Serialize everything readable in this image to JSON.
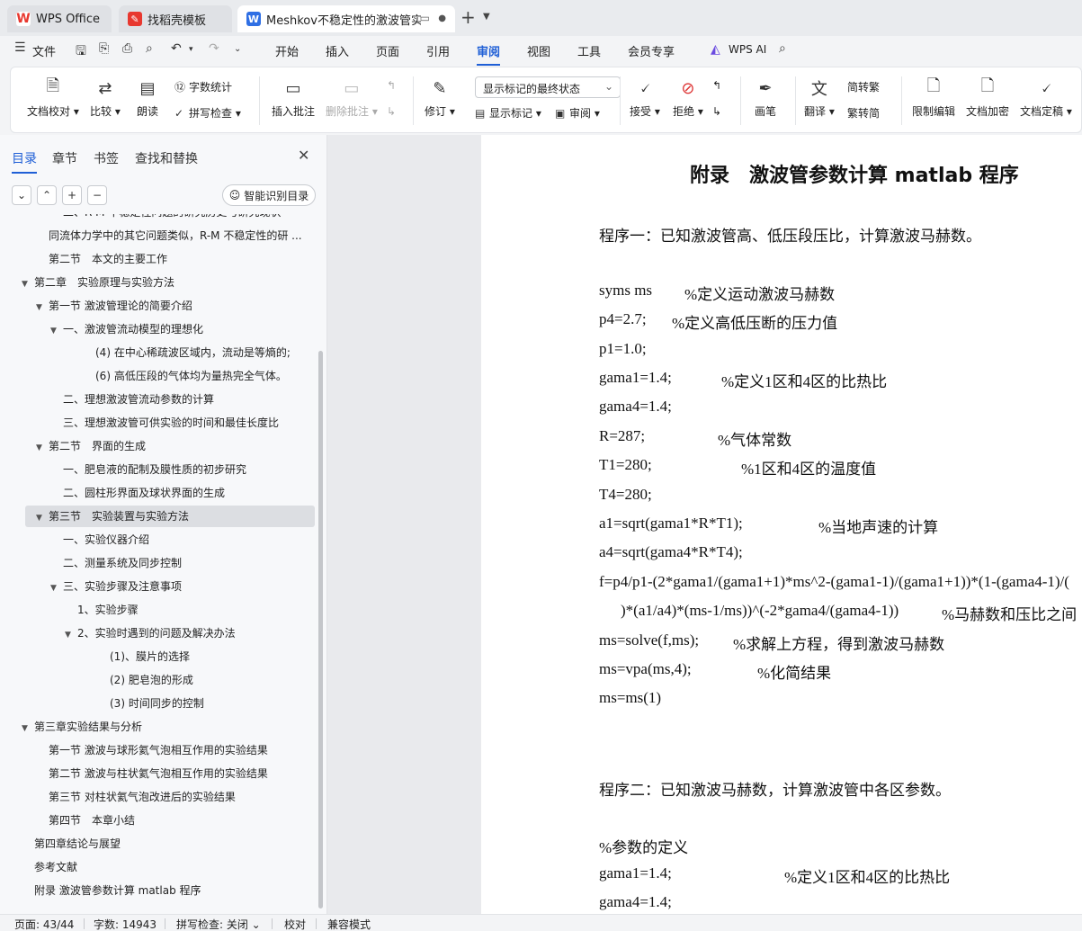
{
  "tabs": {
    "wps_office": "WPS Office",
    "template": "找稻壳模板",
    "document": "Meshkov不稳定性的激波管实"
  },
  "menu": {
    "file": "文件",
    "items": [
      "开始",
      "插入",
      "页面",
      "引用",
      "审阅",
      "视图",
      "工具",
      "会员专享"
    ],
    "active": "审阅",
    "wps_ai": "WPS AI"
  },
  "ribbon": {
    "doc_check": "文档校对",
    "compare": "比较",
    "read_aloud": "朗读",
    "word_count": "字数统计",
    "spell_check": "拼写检查",
    "insert_comment": "插入批注",
    "delete_comment": "删除批注",
    "revise": "修订",
    "markup_mode": "显示标记的最终状态",
    "show_markup": "显示标记",
    "review_pane": "审阅",
    "accept": "接受",
    "reject": "拒绝",
    "pen": "画笔",
    "translate": "翻译",
    "to_traditional": "简转繁",
    "to_simplified": "繁转简",
    "restrict_edit": "限制编辑",
    "encrypt": "文档加密",
    "finalize": "文档定稿"
  },
  "sidebar": {
    "tabs": [
      "目录",
      "章节",
      "书签",
      "查找和替换"
    ],
    "smart_toc": "智能识别目录",
    "toc": [
      {
        "text": "二、R-M 不稳定性问题的研究历史与研究现状",
        "level": 3,
        "arrow": ""
      },
      {
        "text": "同流体力学中的其它问题类似，R-M 不稳定性的研 ...",
        "level": 2,
        "arrow": ""
      },
      {
        "text": "第二节　本文的主要工作",
        "level": 2,
        "arrow": ""
      },
      {
        "text": "第二章　实验原理与实验方法",
        "level": 1,
        "arrow": "▼"
      },
      {
        "text": "第一节  激波管理论的简要介绍",
        "level": 2,
        "arrow": "▼"
      },
      {
        "text": "一、激波管流动模型的理想化",
        "level": 3,
        "arrow": "▼"
      },
      {
        "text": "(4) 在中心稀疏波区域内，流动是等熵的;",
        "level": 5,
        "arrow": ""
      },
      {
        "text": "(6) 高低压段的气体均为量热完全气体。",
        "level": 5,
        "arrow": ""
      },
      {
        "text": "二、理想激波管流动参数的计算",
        "level": 3,
        "arrow": ""
      },
      {
        "text": "三、理想激波管可供实验的时间和最佳长度比",
        "level": 3,
        "arrow": ""
      },
      {
        "text": "第二节　界面的生成",
        "level": 2,
        "arrow": "▼"
      },
      {
        "text": "一、肥皂液的配制及膜性质的初步研究",
        "level": 3,
        "arrow": ""
      },
      {
        "text": "二、圆柱形界面及球状界面的生成",
        "level": 3,
        "arrow": ""
      },
      {
        "text": "第三节　实验装置与实验方法",
        "level": 2,
        "arrow": "▼",
        "selected": true
      },
      {
        "text": "一、实验仪器介绍",
        "level": 3,
        "arrow": ""
      },
      {
        "text": "二、测量系统及同步控制",
        "level": 3,
        "arrow": ""
      },
      {
        "text": "三、实验步骤及注意事项",
        "level": 3,
        "arrow": "▼"
      },
      {
        "text": "1、实验步骤",
        "level": 4,
        "arrow": ""
      },
      {
        "text": "2、实验时遇到的问题及解决办法",
        "level": 4,
        "arrow": "▼"
      },
      {
        "text": "(1)、膜片的选择",
        "level": 6,
        "arrow": ""
      },
      {
        "text": "(2) 肥皂泡的形成",
        "level": 6,
        "arrow": ""
      },
      {
        "text": "(3) 时间同步的控制",
        "level": 6,
        "arrow": ""
      },
      {
        "text": "第三章实验结果与分析",
        "level": 1,
        "arrow": "▼"
      },
      {
        "text": "第一节  激波与球形氦气泡相互作用的实验结果",
        "level": 2,
        "arrow": ""
      },
      {
        "text": "第二节  激波与柱状氦气泡相互作用的实验结果",
        "level": 2,
        "arrow": ""
      },
      {
        "text": "第三节  对柱状氦气泡改进后的实验结果",
        "level": 2,
        "arrow": ""
      },
      {
        "text": "第四节　本章小结",
        "level": 2,
        "arrow": ""
      },
      {
        "text": "第四章结论与展望",
        "level": 1,
        "arrow": ""
      },
      {
        "text": "参考文献",
        "level": 1,
        "arrow": ""
      },
      {
        "text": "附录  激波管参数计算 matlab 程序",
        "level": 1,
        "arrow": ""
      }
    ]
  },
  "document": {
    "title": "附录　激波管参数计算 matlab 程序",
    "lines": [
      {
        "code": "程序一：已知激波管高、低压段压比，计算激波马赫数。",
        "comment": ""
      },
      {
        "code": "",
        "comment": ""
      },
      {
        "code": "syms ms",
        "comment": "%定义运动激波马赫数"
      },
      {
        "code": "p4=2.7;",
        "comment": "%定义高低压断的压力值"
      },
      {
        "code": "p1=1.0;",
        "comment": ""
      },
      {
        "code": "gama1=1.4;",
        "comment": "%定义1区和4区的比热比"
      },
      {
        "code": "gama4=1.4;",
        "comment": ""
      },
      {
        "code": "R=287;",
        "comment": "%气体常数"
      },
      {
        "code": "T1=280;",
        "comment": "%1区和4区的温度值"
      },
      {
        "code": "T4=280;",
        "comment": ""
      },
      {
        "code": "a1=sqrt(gama1*R*T1);",
        "comment": "%当地声速的计算"
      },
      {
        "code": "a4=sqrt(gama4*R*T4);",
        "comment": ""
      },
      {
        "code": "f=p4/p1-(2*gama1/(gama1+1)*ms^2-(gama1-1)/(gama1+1))*(1-(gama4-1)/(",
        "comment": ""
      },
      {
        "code": ")*(a1/a4)*(ms-1/ms))^(-2*gama4/(gama4-1))",
        "comment": "%马赫数和压比之间"
      },
      {
        "code": "ms=solve(f,ms);",
        "comment": "%求解上方程，得到激波马赫数"
      },
      {
        "code": "ms=vpa(ms,4);",
        "comment": "%化简结果"
      },
      {
        "code": "ms=ms(1)",
        "comment": ""
      },
      {
        "code": "",
        "comment": ""
      },
      {
        "code": "",
        "comment": ""
      },
      {
        "code": "程序二：已知激波马赫数，计算激波管中各区参数。",
        "comment": ""
      },
      {
        "code": "",
        "comment": ""
      },
      {
        "code": "%参数的定义",
        "comment": ""
      },
      {
        "code": "gama1=1.4;",
        "comment": "%定义1区和4区的比热比"
      },
      {
        "code": "gama4=1.4;",
        "comment": ""
      }
    ]
  },
  "status": {
    "page": "页面: 43/44",
    "words": "字数: 14943",
    "spell": "拼写检查: 关闭",
    "proof": "校对",
    "compat": "兼容模式"
  },
  "colors": {
    "accent": "#1f5fd6",
    "wps_red": "#e8382f"
  }
}
